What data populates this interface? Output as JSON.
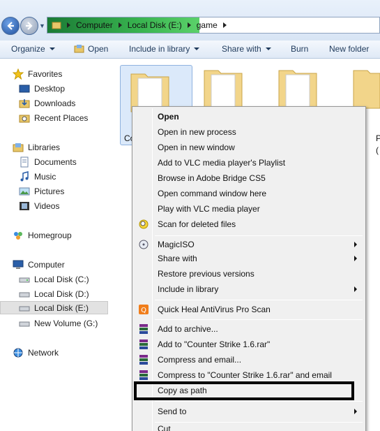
{
  "breadcrumb": {
    "items": [
      "Computer",
      "Local Disk (E:)",
      "game"
    ]
  },
  "toolbar": {
    "organize": "Organize",
    "open": "Open",
    "include": "Include in library",
    "share": "Share with",
    "burn": "Burn",
    "new_folder": "New folder"
  },
  "nav": {
    "favorites": "Favorites",
    "desktop": "Desktop",
    "downloads": "Downloads",
    "recent": "Recent Places",
    "libraries": "Libraries",
    "documents": "Documents",
    "music": "Music",
    "pictures": "Pictures",
    "videos": "Videos",
    "homegroup": "Homegroup",
    "computer": "Computer",
    "disk_c": "Local Disk (C:)",
    "disk_d": "Local Disk (D:)",
    "disk_e": "Local Disk (E:)",
    "volume_g": "New Volume (G:)",
    "network": "Network"
  },
  "content": {
    "partial_label_left": "Co",
    "partial_label_right": "P",
    "partial_label_right2": "("
  },
  "menu": {
    "open": "Open",
    "open_new_process": "Open in new process",
    "open_new_window": "Open in new window",
    "add_vlc_playlist": "Add to VLC media player's Playlist",
    "browse_bridge": "Browse in Adobe Bridge CS5",
    "open_cmd": "Open command window here",
    "play_vlc": "Play with VLC media player",
    "scan_deleted": "Scan for deleted files",
    "magiciso": "MagicISO",
    "share_with": "Share with",
    "restore": "Restore previous versions",
    "include_library": "Include in library",
    "quickheal": "Quick Heal AntiVirus Pro Scan",
    "add_archive": "Add to archive...",
    "add_rar": "Add to \"Counter Strike 1.6.rar\"",
    "compress_email": "Compress and email...",
    "compress_rar_email": "Compress to \"Counter Strike 1.6.rar\" and email",
    "copy_path": "Copy as path",
    "send_to": "Send to",
    "cut_partial": "Cut"
  },
  "colors": {
    "breadcrumb_highlight": "#2fa046",
    "menu_bg": "#f0f0f0",
    "toolbar_text": "#1e395b"
  }
}
